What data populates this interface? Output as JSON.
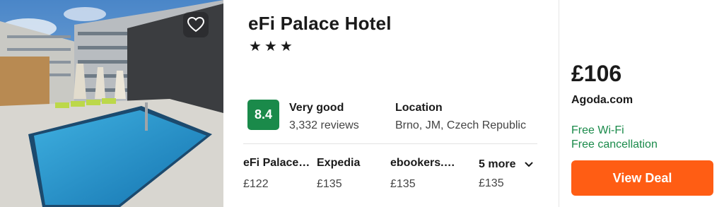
{
  "hotel": {
    "name": "eFi Palace Hotel",
    "stars": "★★★",
    "score": "8.4",
    "rating_word": "Very good",
    "reviews": "3,332 reviews",
    "location_label": "Location",
    "location_value": "Brno, JM, Czech Republic"
  },
  "providers": [
    {
      "name": "eFi Palace…",
      "price": "£122"
    },
    {
      "name": "Expedia",
      "price": "£135"
    },
    {
      "name": "ebookers.…",
      "price": "£135"
    }
  ],
  "more": {
    "label": "5 more",
    "price": "£135"
  },
  "deal": {
    "price": "£106",
    "site": "Agoda.com",
    "features": [
      "Free Wi-Fi",
      "Free cancellation"
    ],
    "button_label": "View Deal"
  },
  "colors": {
    "score_badge": "#1a8a4a",
    "feature_text": "#1a8a4a",
    "deal_button": "#ff5d14"
  },
  "icons": {
    "favorite": "heart-icon",
    "more": "chevron-down-icon"
  }
}
